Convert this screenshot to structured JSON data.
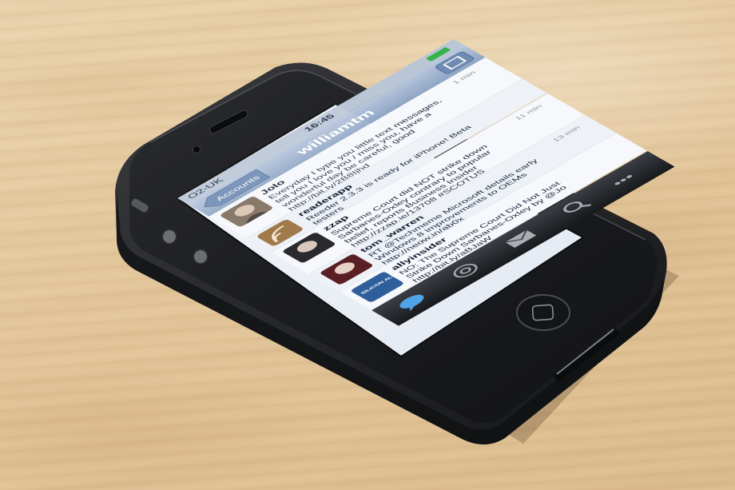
{
  "status_bar": {
    "carrier": "O2-UK",
    "time": "16:45"
  },
  "nav_bar": {
    "title": "williamtm",
    "back_label": "Accounts"
  },
  "tweets": [
    {
      "name": "Jolo",
      "line1": "Everyday I type you little text messages,",
      "line2": "tell you I love you / miss you, have a",
      "line3": "wonderful day be careful, good",
      "line4": "http://bit.ly/2B8Ijhd",
      "time": "1 min"
    },
    {
      "name": "readerapp",
      "line1": "Reeder 2.3.3 is ready for iPhone! Beta",
      "line2": "testers",
      "line3": "",
      "line4": "",
      "time": ""
    },
    {
      "name": "zzap",
      "line1": "Supreme Court did NOT strike down",
      "line2": "Sarbanes-Oxley contrary to popular",
      "line3": "belief, reports Business Insider",
      "line4": "http://zzap.ie/13708 #SCOTUS",
      "time": "11 min"
    },
    {
      "name": "tom_warren",
      "line1": "RT @Techmeme Microsoft details early",
      "line2": "Windows 8 improvements to OEMs",
      "line3": "http://neow.in/ab0x",
      "line4": "",
      "time": "13 min"
    },
    {
      "name": "allyinsider",
      "line1": "NO: The Supreme Court Did Not Just",
      "line2": "Strike Down Sarbanes-Oxley by @Jo",
      "line3": "http://bit.ly/aBJaW",
      "line4": "",
      "time": ""
    }
  ],
  "avatar_badge": "SILICON ALLEY INSIDER",
  "tab_bar": {
    "icons": [
      "speech-bubble-icon",
      "at-sign-icon",
      "inbox-icon",
      "search-icon",
      "more-icon"
    ],
    "more_label": "•••"
  },
  "colors": {
    "phone_body": "#1b1c1e",
    "bumper": "#2a2b2e",
    "nav_bar": "#9fb3cf",
    "screen_bg": "#eef2f8",
    "desk": "#e4c79b"
  }
}
